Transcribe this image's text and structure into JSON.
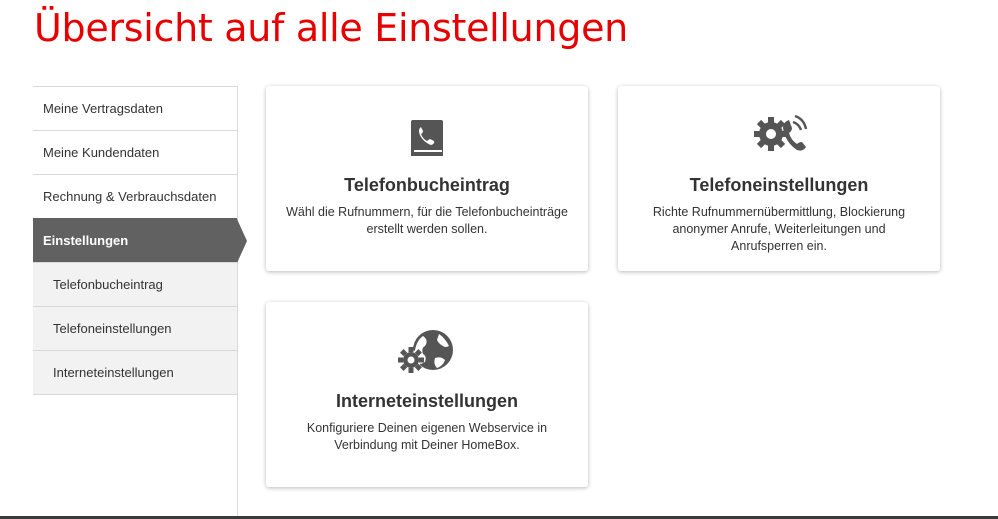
{
  "page": {
    "title": "Übersicht auf alle Einstellungen"
  },
  "sidebar": {
    "items": [
      {
        "label": "Meine Vertragsdaten"
      },
      {
        "label": "Meine Kundendaten"
      },
      {
        "label": "Rechnung & Verbrauchsdaten"
      },
      {
        "label": "Einstellungen",
        "active": true
      },
      {
        "label": "Telefonbucheintrag",
        "sub": true
      },
      {
        "label": "Telefoneinstellungen",
        "sub": true
      },
      {
        "label": "Interneteinstellungen",
        "sub": true
      }
    ]
  },
  "cards": [
    {
      "icon": "phonebook-icon",
      "title": "Telefonbucheintrag",
      "description": "Wähl die Rufnummern, für die Telefonbucheinträge erstellt werden sollen."
    },
    {
      "icon": "gear-phone-icon",
      "title": "Telefoneinstellungen",
      "description": "Richte Rufnummernübermittlung, Blockierung anonymer Anrufe, Weiterleitungen und Anrufsperren ein."
    },
    {
      "icon": "gear-globe-icon",
      "title": "Interneteinstellungen",
      "description": "Konfiguriere Deinen eigenen Webservice in Verbindung mit Deiner HomeBox."
    }
  ],
  "colors": {
    "brand": "#e60000",
    "active_nav": "#616161",
    "icon": "#555555"
  }
}
